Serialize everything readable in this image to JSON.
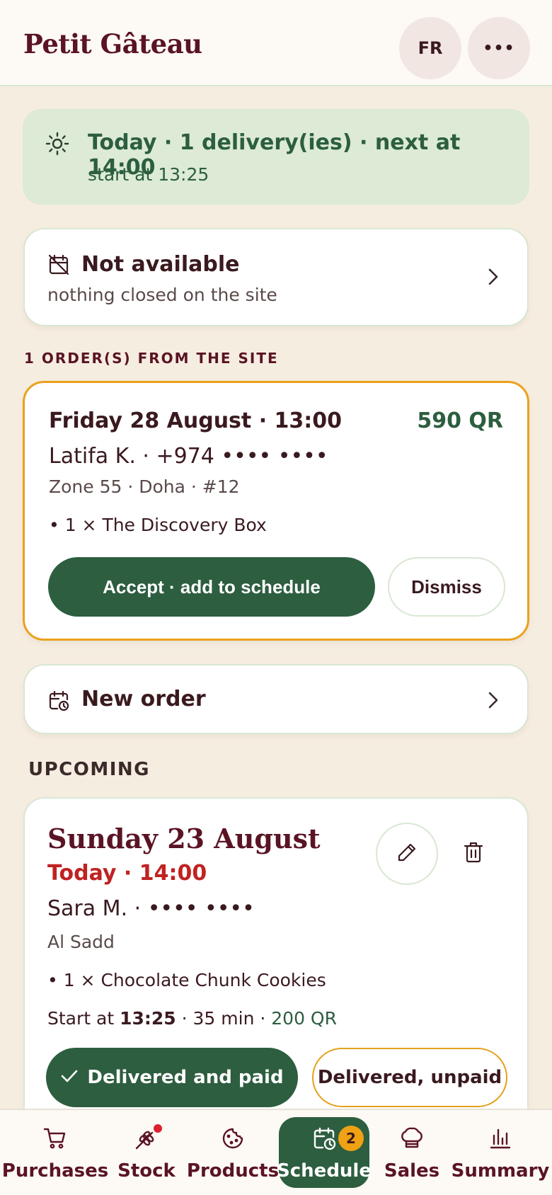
{
  "header": {
    "brand": "Petit Gâteau",
    "lang_label": "FR",
    "more_label": "•••"
  },
  "today_banner": {
    "icon": "sun-icon",
    "title": "Today · 1 delivery(ies) · next at 14:00",
    "subtitle": "start at 13:25"
  },
  "availability": {
    "icon": "calendar-off-icon",
    "title": "Not available",
    "subtitle": "nothing closed on the site"
  },
  "site_orders": {
    "section_label": "1 ORDER(S) FROM THE SITE",
    "order": {
      "when": "Friday 28 August · 13:00",
      "amount": "590 QR",
      "customer": "Latifa K. · +974 •••• ••••",
      "address": "Zone 55 · Doha · #12",
      "items": [
        "• 1 × The Discovery Box"
      ],
      "accept_label": "Accept · add to schedule",
      "dismiss_label": "Dismiss"
    }
  },
  "new_order": {
    "icon": "calendar-clock-icon",
    "label": "New order"
  },
  "upcoming": {
    "section_label": "UPCOMING",
    "card": {
      "date": "Sunday 23 August",
      "today_time": "Today · 14:00",
      "customer": "Sara M. · •••• ••••",
      "address": "Al Sadd",
      "items": [
        "• 1 × Chocolate Chunk Cookies"
      ],
      "start_prefix": "Start at ",
      "start_time": "13:25",
      "duration": " · 35 min · ",
      "price": "200 QR",
      "paid_label": "Delivered and paid",
      "unpaid_label": "Delivered, unpaid"
    }
  },
  "bottom_nav": {
    "items": [
      {
        "label": "Purchases",
        "icon": "cart-icon"
      },
      {
        "label": "Stock",
        "icon": "wheat-icon"
      },
      {
        "label": "Products",
        "icon": "cookie-icon"
      },
      {
        "label": "Schedule",
        "icon": "calendar-clock-icon",
        "badge": "2",
        "active": true
      },
      {
        "label": "Sales",
        "icon": "chef-hat-icon"
      },
      {
        "label": "Summary",
        "icon": "bar-chart-icon"
      }
    ]
  },
  "colors": {
    "primary_green": "#2d5e3f",
    "burgundy": "#5a1424",
    "accent_orange": "#eba11d",
    "alert_red": "#c02222",
    "background": "#f6ede1"
  }
}
